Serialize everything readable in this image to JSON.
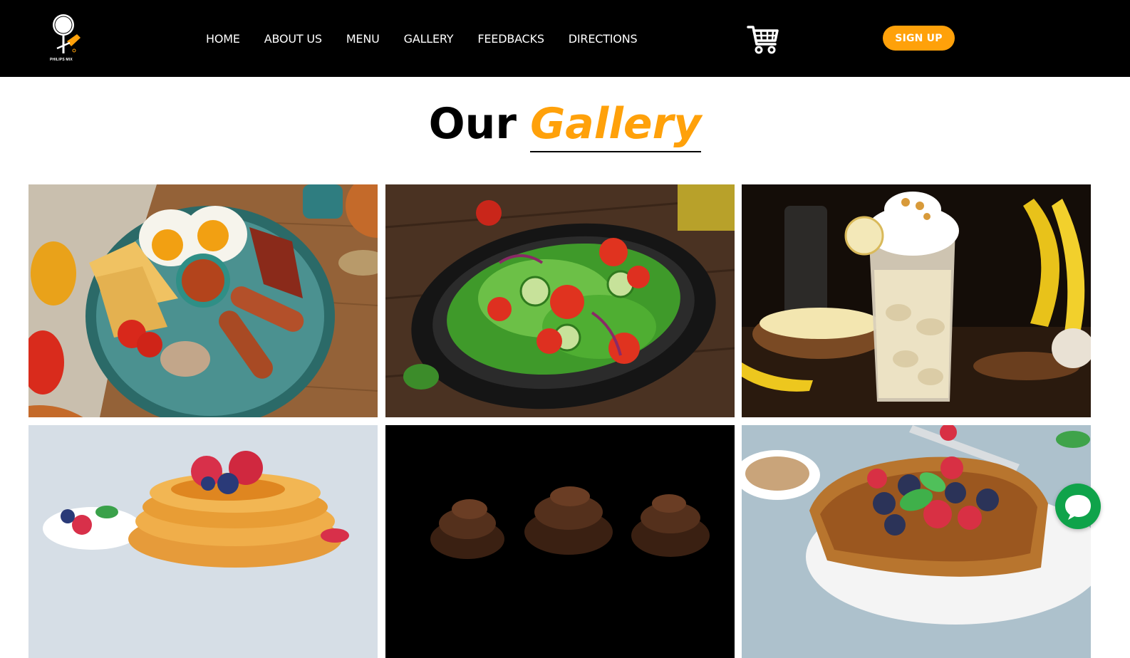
{
  "header": {
    "logo_text": "PHILIPS MIX",
    "nav": [
      "HOME",
      "ABOUT US",
      "MENU",
      "GALLERY",
      "FEEDBACKS",
      "DIRECTIONS"
    ],
    "signup_label": "SIGN UP"
  },
  "title": {
    "word1": "Our",
    "word2": "Gallery"
  },
  "colors": {
    "accent": "#ffa10a",
    "header_bg": "#000000",
    "chat": "#0fa34a"
  },
  "gallery": [
    {
      "icon": "breakfast-plate-image"
    },
    {
      "icon": "salad-bowl-image"
    },
    {
      "icon": "banana-milkshake-image"
    },
    {
      "icon": "pancakes-image"
    },
    {
      "icon": "chocolate-cupcakes-image"
    },
    {
      "icon": "french-toast-image"
    }
  ],
  "chat_icon": "chat-bubble-icon",
  "cart_icon": "cart-icon"
}
